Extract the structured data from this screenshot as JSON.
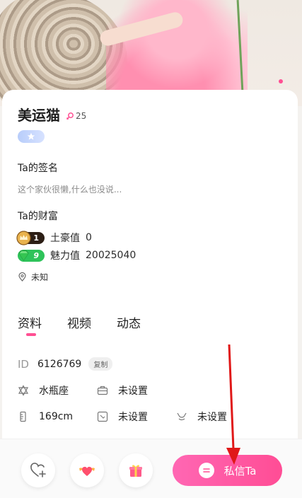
{
  "profile": {
    "name": "美运猫",
    "age": "25"
  },
  "signature": {
    "title": "Ta的签名",
    "text": "这个家伙很懒,什么也没说..."
  },
  "wealth": {
    "title": "Ta的财富",
    "tycoon_level": "1",
    "tycoon_label": "土豪值",
    "tycoon_value": "0",
    "charm_level": "9",
    "charm_label": "魅力值",
    "charm_value": "20025040"
  },
  "location": "未知",
  "tabs": [
    "资料",
    "视频",
    "动态"
  ],
  "details": {
    "id_label": "ID",
    "id_value": "6126769",
    "copy_label": "复制",
    "zodiac": "水瓶座",
    "job": "未设置",
    "height": "169cm",
    "field2": "未设置",
    "field3": "未设置"
  },
  "actions": {
    "chat_label": "私信Ta"
  },
  "colors": {
    "accent": "#ff4f93",
    "charm_green": "#2ec35a"
  }
}
